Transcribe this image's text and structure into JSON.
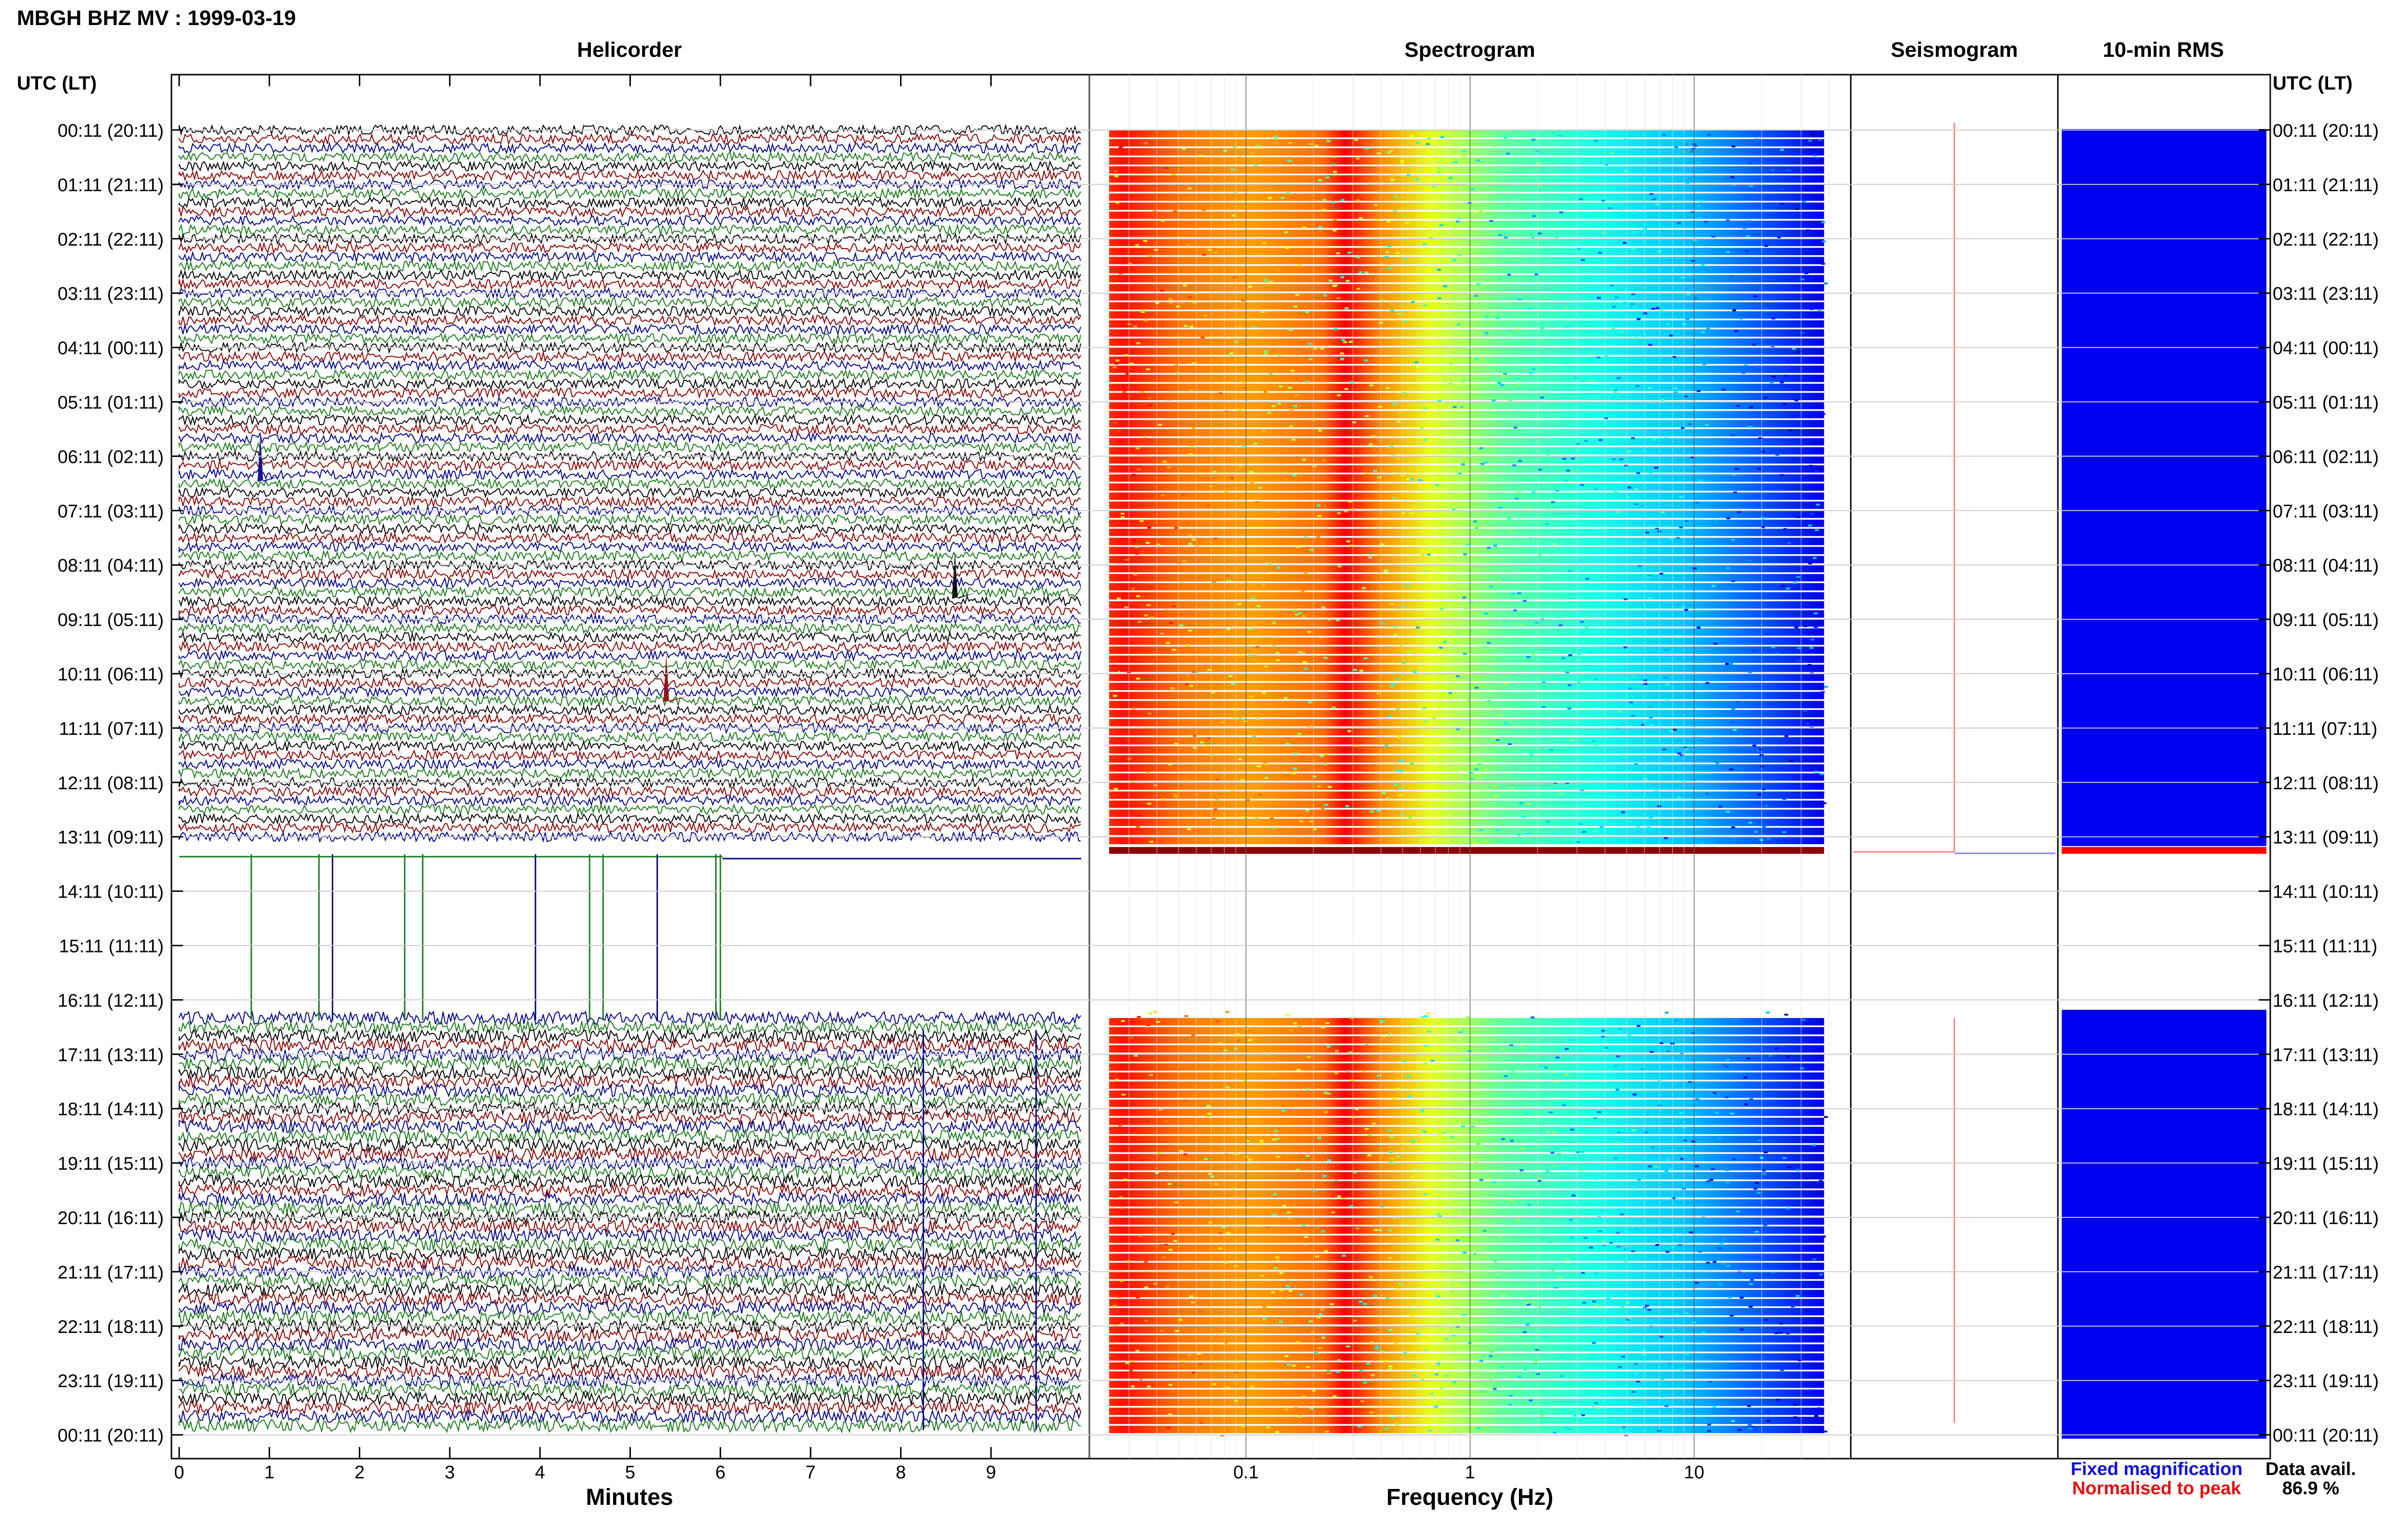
{
  "header": {
    "station_title": "MBGH BHZ MV : 1999-03-19",
    "panel_titles": [
      "Helicorder",
      "Spectrogram",
      "Seismogram",
      "10-min RMS"
    ],
    "time_axis_label": "UTC (LT)"
  },
  "time_labels": [
    "00:11 (20:11)",
    "01:11 (21:11)",
    "02:11 (22:11)",
    "03:11 (23:11)",
    "04:11 (00:11)",
    "05:11 (01:11)",
    "06:11 (02:11)",
    "07:11 (03:11)",
    "08:11 (04:11)",
    "09:11 (05:11)",
    "10:11 (06:11)",
    "11:11 (07:11)",
    "12:11 (08:11)",
    "13:11 (09:11)",
    "14:11 (10:11)",
    "15:11 (11:11)",
    "16:11 (12:11)",
    "17:11 (13:11)",
    "18:11 (14:11)",
    "19:11 (15:11)",
    "20:11 (16:11)",
    "21:11 (17:11)",
    "22:11 (18:11)",
    "23:11 (19:11)",
    "00:11 (20:11)"
  ],
  "legend": {
    "fixed": "Fixed magnification",
    "normalised": "Normalised to peak",
    "fixed_color": "#1010e0",
    "normalised_color": "#e01010"
  },
  "availability": {
    "label": "Data avail.",
    "value": "86.9 %"
  },
  "colors": {
    "trace_cycle": [
      "#000000",
      "#8b0000",
      "#00008b",
      "#1a7a1a"
    ],
    "rms_fill": "#0000f0",
    "rms_peak": "#ff0000",
    "grid": "#cccccc"
  },
  "chart_data": [
    {
      "type": "line",
      "title": "Helicorder",
      "xlabel": "Minutes",
      "x_ticks": [
        "0",
        "1",
        "2",
        "3",
        "4",
        "5",
        "6",
        "7",
        "8",
        "9"
      ],
      "xlim": [
        0,
        10
      ],
      "rows_per_hour": 6,
      "row_span_hours": 24,
      "gap_hours": [
        13.1,
        16.2
      ],
      "events": [
        {
          "hour": 6.25,
          "minute": 0.9,
          "color": "#00008b"
        },
        {
          "hour": 10.3,
          "minute": 5.4,
          "color": "#8b0000"
        },
        {
          "hour": 8.4,
          "minute": 8.6,
          "color": "#000000"
        }
      ]
    },
    {
      "type": "heatmap",
      "title": "Spectrogram",
      "xlabel": "Frequency (Hz)",
      "x_scale": "log",
      "xlim": [
        0.02,
        50
      ],
      "x_ticks": [
        "0.1",
        "1",
        "10"
      ],
      "valid_hours": [
        [
          0,
          13.1
        ],
        [
          16.2,
          24
        ]
      ],
      "colormap": "jet"
    },
    {
      "type": "line",
      "title": "Seismogram",
      "series": [
        {
          "name": "Fixed magnification",
          "color": "#1010e0"
        },
        {
          "name": "Normalised to peak",
          "color": "#e01010"
        }
      ]
    },
    {
      "type": "bar",
      "title": "10-min RMS",
      "valid_hours": [
        [
          0,
          13.1
        ],
        [
          16.2,
          24
        ]
      ],
      "peak_hour": 13.1
    }
  ]
}
